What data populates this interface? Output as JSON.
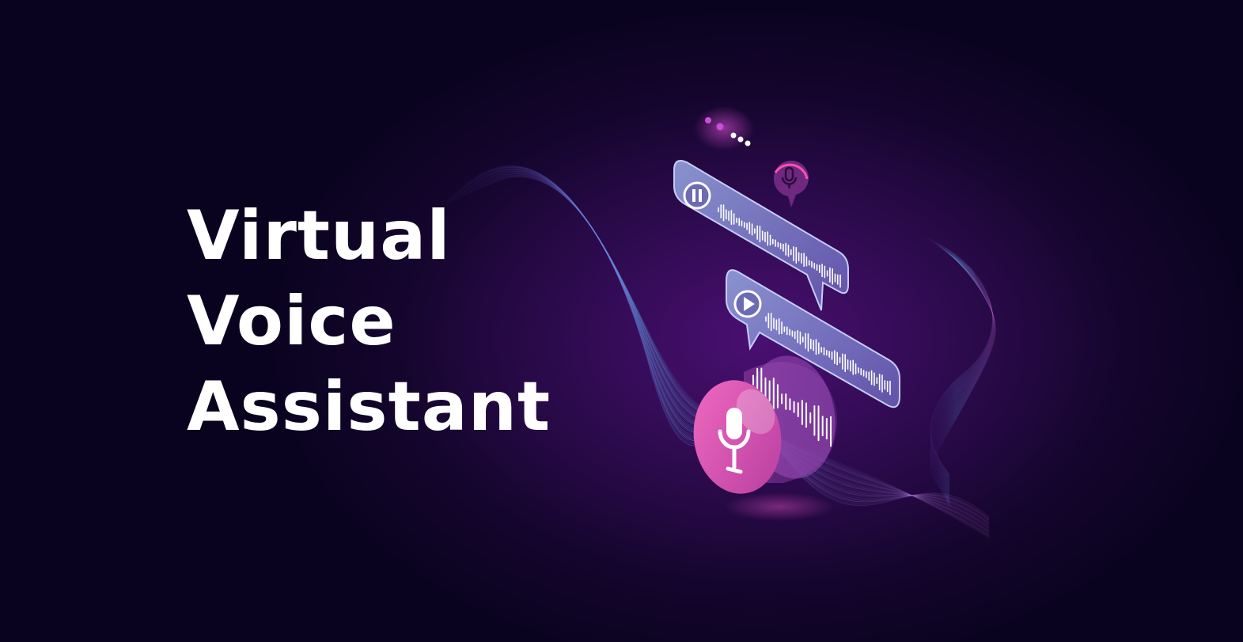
{
  "headline": {
    "line1": "Virtual",
    "line2": "Voice",
    "line3": "Assistant"
  },
  "palette": {
    "background": "#0c0420",
    "glow": "#4a0f72",
    "bubble": "#7f8bc8",
    "accent_pink": "#e14fb0",
    "wave": "#5fa8e8",
    "text": "#ffffff"
  },
  "icons": [
    "pause-icon",
    "play-icon",
    "microphone-icon",
    "typing-dots-icon"
  ]
}
